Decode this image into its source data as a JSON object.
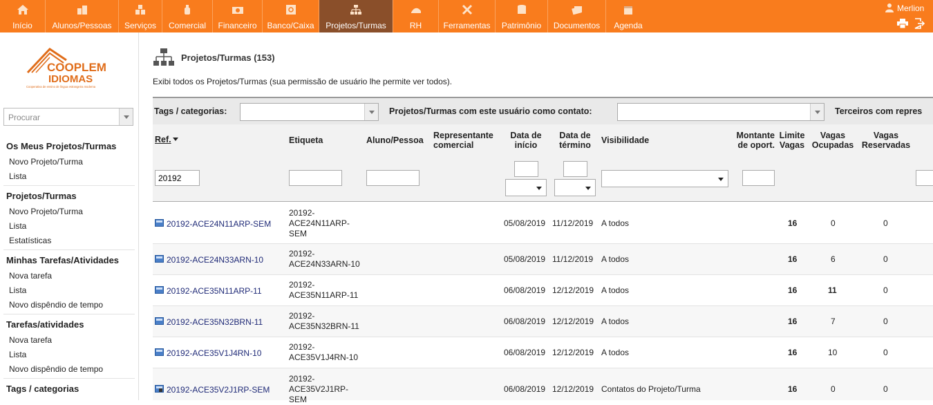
{
  "nav": {
    "tabs": [
      {
        "label": "Início",
        "icon": "home-icon"
      },
      {
        "label": "Alunos/Pessoas",
        "icon": "building-icon"
      },
      {
        "label": "Serviços",
        "icon": "boxes-icon"
      },
      {
        "label": "Comercial",
        "icon": "bottle-icon"
      },
      {
        "label": "Financeiro",
        "icon": "money-icon"
      },
      {
        "label": "Banco/Caixa",
        "icon": "safe-icon"
      },
      {
        "label": "Projetos/Turmas",
        "icon": "hierarchy-icon"
      },
      {
        "label": "RH",
        "icon": "hr-icon"
      },
      {
        "label": "Ferramentas",
        "icon": "tools-icon"
      },
      {
        "label": "Patrimônio",
        "icon": "database-icon"
      },
      {
        "label": "Documentos",
        "icon": "documents-icon"
      },
      {
        "label": "Agenda",
        "icon": "calendar-icon"
      }
    ],
    "user": "Merlion",
    "accent": "#f97c1d",
    "active_bg": "#8a4f2a"
  },
  "sidebar": {
    "logo_text_1": "COOPLEM",
    "logo_text_2": "IDIOMAS",
    "logo_tagline": "Cooperativa de ensino de língua estrangeira moderna",
    "search_placeholder": "Procurar",
    "sections": [
      {
        "title": "Os Meus Projetos/Turmas",
        "items": [
          "Novo Projeto/Turma",
          "Lista"
        ]
      },
      {
        "title": "Projetos/Turmas",
        "items": [
          "Novo Projeto/Turma",
          "Lista",
          "Estatísticas"
        ]
      },
      {
        "title": "Minhas Tarefas/Atividades",
        "items": [
          "Nova tarefa",
          "Lista",
          "Novo dispêndio de tempo"
        ]
      },
      {
        "title": "Tarefas/atividades",
        "items": [
          "Nova tarefa",
          "Lista",
          "Novo dispêndio de tempo"
        ]
      },
      {
        "title": "Tags / categorias",
        "items": []
      }
    ]
  },
  "main": {
    "title": "Projetos/Turmas (153)",
    "description": "Exibi todos os Projetos/Turmas (sua permissão de usuário lhe permite ver todos).",
    "filters": {
      "tags_label": "Tags / categorias:",
      "contact_label": "Projetos/Turmas com este usuário como contato:",
      "third_label": "Terceiros com repres"
    },
    "columns": {
      "ref": "Ref.",
      "etiqueta": "Etiqueta",
      "aluno": "Aluno/Pessoa",
      "rep1": "Representante",
      "rep2": "comercial",
      "inicio1": "Data de",
      "inicio2": "início",
      "termino1": "Data de",
      "termino2": "término",
      "visibilidade": "Visibilidade",
      "montante1": "Montante",
      "montante2": "de oport.",
      "limite1": "Limite",
      "limite2": "Vagas",
      "ocup1": "Vagas",
      "ocup2": "Ocupadas",
      "res1": "Vagas",
      "res2": "Reservadas"
    },
    "filter_ref_value": "20192",
    "rows": [
      {
        "ref": "20192-ACE24N11ARP-SEM",
        "label": "20192-ACE24N11ARP-SEM",
        "inicio": "05/08/2019",
        "termino": "11/12/2019",
        "vis": "A todos",
        "limite": "16",
        "ocupadas": "0",
        "reservadas": "0"
      },
      {
        "ref": "20192-ACE24N33ARN-10",
        "label": "20192-ACE24N33ARN-10",
        "inicio": "05/08/2019",
        "termino": "11/12/2019",
        "vis": "A todos",
        "limite": "16",
        "ocupadas": "6",
        "reservadas": "0"
      },
      {
        "ref": "20192-ACE35N11ARP-11",
        "label": "20192-ACE35N11ARP-11",
        "inicio": "06/08/2019",
        "termino": "12/12/2019",
        "vis": "A todos",
        "limite": "16",
        "ocupadas": "11",
        "reservadas": "0"
      },
      {
        "ref": "20192-ACE35N32BRN-11",
        "label": "20192-ACE35N32BRN-11",
        "inicio": "06/08/2019",
        "termino": "12/12/2019",
        "vis": "A todos",
        "limite": "16",
        "ocupadas": "7",
        "reservadas": "0"
      },
      {
        "ref": "20192-ACE35V1J4RN-10",
        "label": "20192-ACE35V1J4RN-10",
        "inicio": "06/08/2019",
        "termino": "12/12/2019",
        "vis": "A todos",
        "limite": "16",
        "ocupadas": "10",
        "reservadas": "0"
      },
      {
        "ref": "20192-ACE35V2J1RP-SEM",
        "label": "20192-ACE35V2J1RP-SEM",
        "inicio": "06/08/2019",
        "termino": "12/12/2019",
        "vis": "Contatos do Projeto/Turma",
        "limite": "16",
        "ocupadas": "0",
        "reservadas": "0"
      }
    ]
  }
}
